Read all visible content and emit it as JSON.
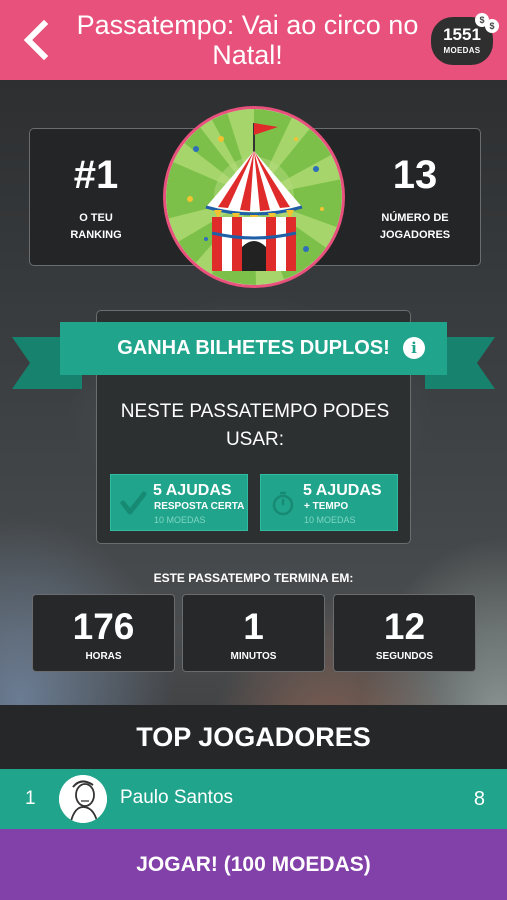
{
  "header": {
    "title": "Passatempo: Vai ao circo no Natal!",
    "coins": "1551",
    "coins_label": "MOEDAS"
  },
  "stats": {
    "ranking_value": "#1",
    "ranking_label_1": "O TEU",
    "ranking_label_2": "RANKING",
    "players_value": "13",
    "players_label_1": "NÚMERO DE",
    "players_label_2": "JOGADORES"
  },
  "promo": {
    "banner": "GANHA BILHETES DUPLOS!",
    "text": "NESTE PASSATEMPO PODES USAR:",
    "helps": [
      {
        "title": "5 AJUDAS",
        "subtitle": "RESPOSTA CERTA",
        "cost": "10 MOEDAS",
        "icon": "check-icon"
      },
      {
        "title": "5 AJUDAS",
        "subtitle": "+ TEMPO",
        "cost": "10 MOEDAS",
        "icon": "stopwatch-icon"
      }
    ]
  },
  "timer": {
    "label": "ESTE PASSATEMPO TERMINA EM:",
    "hours": "176",
    "hours_label": "HORAS",
    "minutes": "1",
    "minutes_label": "MINUTOS",
    "seconds": "12",
    "seconds_label": "SEGUNDOS"
  },
  "leaderboard": {
    "title": "TOP JOGADORES",
    "players": [
      {
        "position": "1",
        "name": "Paulo Santos",
        "score": "8"
      }
    ]
  },
  "play_button": "JOGAR! (100 MOEDAS)",
  "colors": {
    "header": "#e7517b",
    "accent": "#21a48c",
    "play": "#8240a9"
  }
}
